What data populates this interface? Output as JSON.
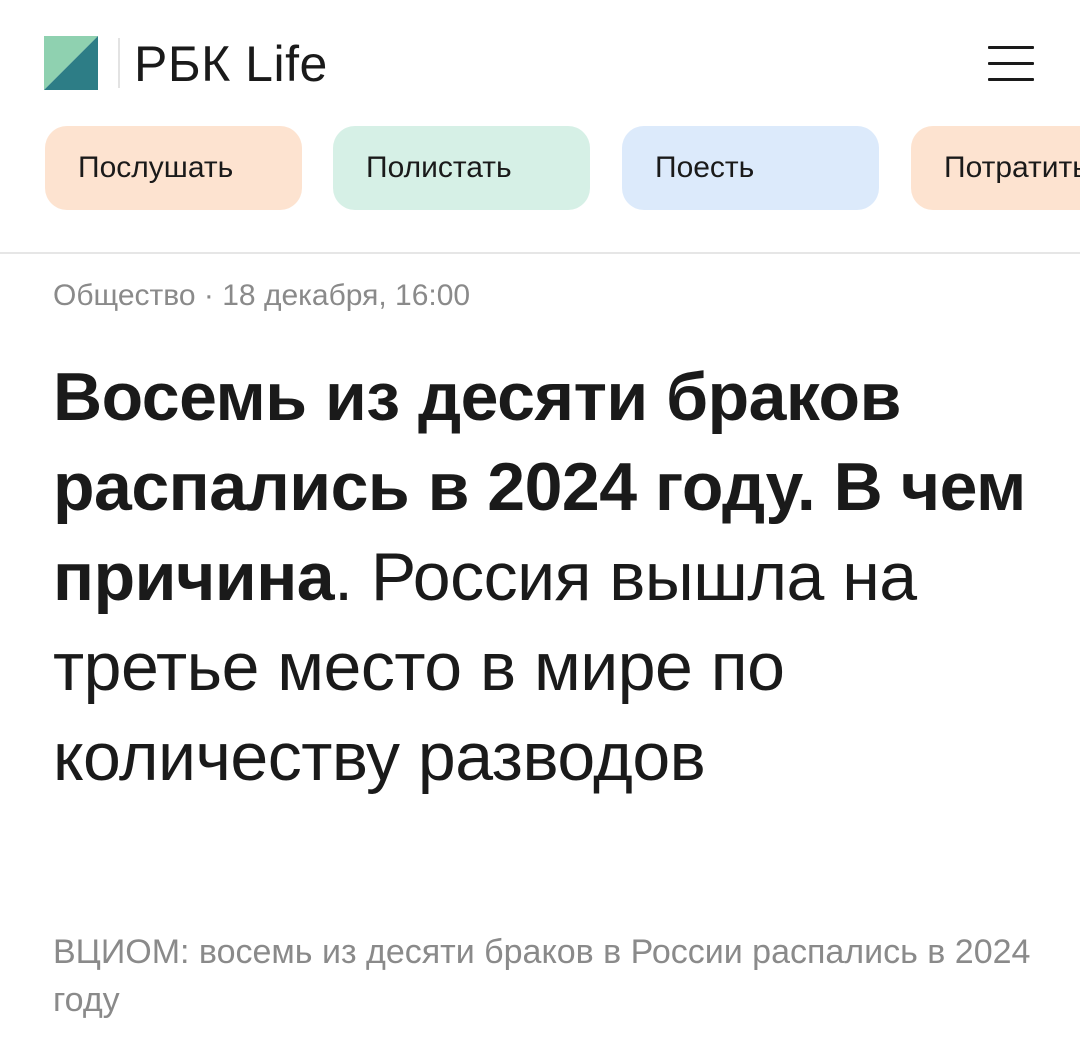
{
  "header": {
    "brand": "РБК Life",
    "logo_icon": "rbc-logo-icon",
    "menu_icon": "hamburger-menu-icon",
    "logo_colors": [
      "#8fd1b0",
      "#2d7d86"
    ]
  },
  "chips": [
    {
      "label": "Послушать",
      "color": "#fde3d0"
    },
    {
      "label": "Полистать",
      "color": "#d6f0e6"
    },
    {
      "label": "Поесть",
      "color": "#dceafb"
    },
    {
      "label": "Потратить",
      "color": "#fde3d0"
    }
  ],
  "article": {
    "meta": "Общество · 18 декабря, 16:00",
    "headline_bold": "Восемь из десяти браков распались в 2024 году. В чем причина",
    "headline_period": ".",
    "headline_light": " Россия вышла на третье место в мире по количеству разводов",
    "lead": "ВЦИОМ: восемь из десяти браков в России распались в 2024 году"
  }
}
